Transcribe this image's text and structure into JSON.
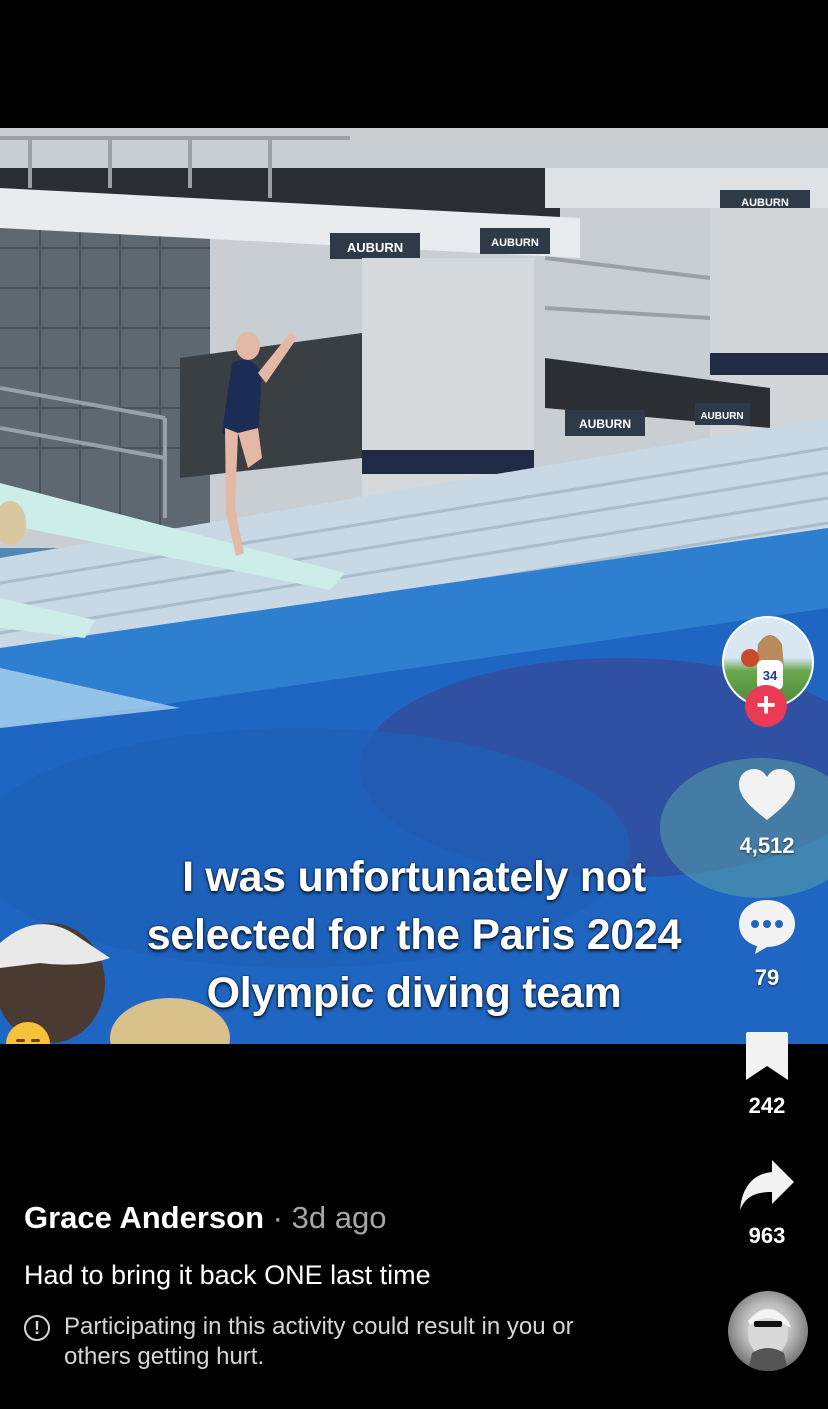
{
  "video": {
    "caption_lines": [
      "I was unfortunately not",
      "selected for the Paris 2024",
      "Olympic diving team"
    ],
    "caption_emoji": "pensive-face-emoji",
    "signage": [
      "AUBURN",
      "AUBURN",
      "AUBURN",
      "AUBURN",
      "AUBURN"
    ]
  },
  "actions": {
    "likes": "4,512",
    "comments": "79",
    "saves": "242",
    "shares": "963"
  },
  "post": {
    "author": "Grace Anderson",
    "separator": "·",
    "time_ago": "3d ago",
    "description": "Had to bring it back ONE last time",
    "warning_icon": "!",
    "warning": "Participating in this activity could result in you or others getting hurt."
  },
  "profile_avatar_jersey": "34",
  "colors": {
    "follow_plus": "#ea3a55",
    "background": "#000000",
    "water": "#1f6fc7"
  }
}
